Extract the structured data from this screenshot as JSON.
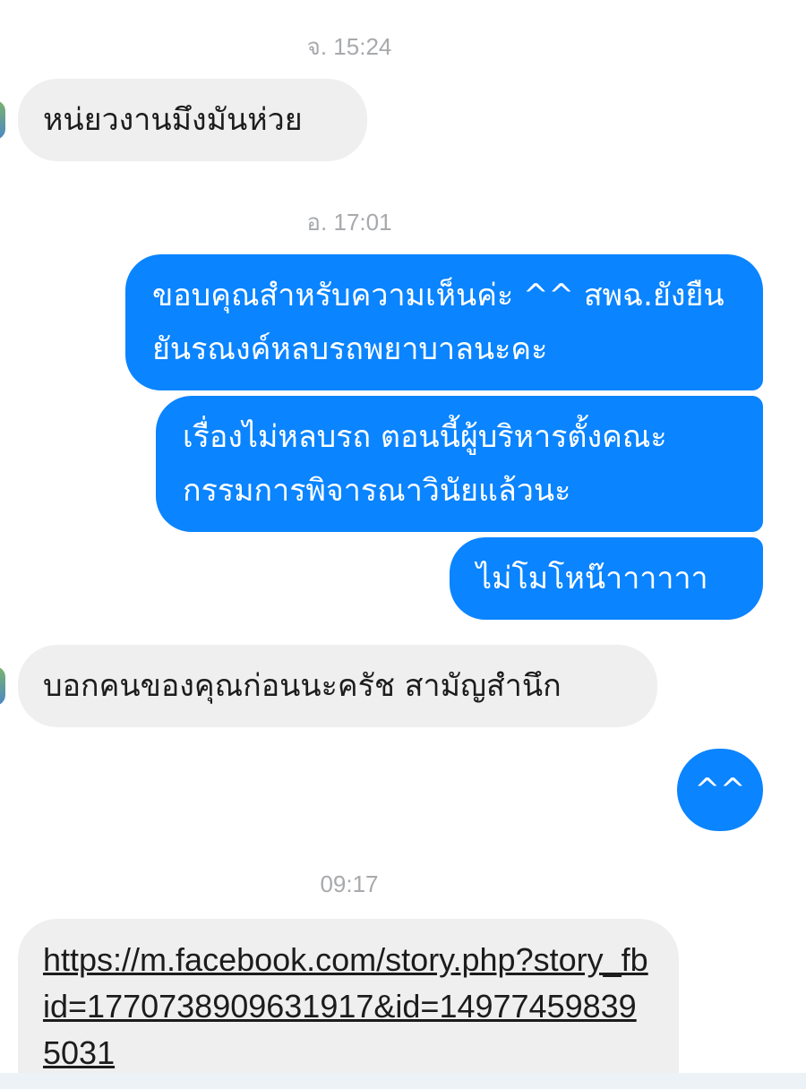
{
  "thread": {
    "groups": [
      {
        "timestamp": "จ. 15:24",
        "messages": [
          {
            "direction": "incoming",
            "text": "หน่ยวงานมึงมันห่วย"
          }
        ]
      },
      {
        "timestamp": "อ. 17:01",
        "messages": [
          {
            "direction": "outgoing",
            "text": "ขอบคุณสำหรับความเห็นค่ะ ^^ สพฉ.ยังยืนยันรณงค์หลบรถพยาบาลนะคะ"
          },
          {
            "direction": "outgoing",
            "text": "เรื่องไม่หลบรถ ตอนนี้ผู้บริหารตั้งคณะกรรมการพิจารณาวินัยแล้วนะ"
          },
          {
            "direction": "outgoing",
            "text": "ไม่โมโหน๊าาาาาา"
          },
          {
            "direction": "incoming",
            "text": "บอกคนของคุณก่อนนะครัช สามัญสำนึก"
          },
          {
            "direction": "outgoing",
            "text": "^^"
          }
        ]
      },
      {
        "timestamp": "09:17",
        "messages": [
          {
            "direction": "incoming",
            "type": "link",
            "text": "https://m.facebook.com/story.php?story_fbid=1770738909631917&id=149774598395031"
          }
        ]
      }
    ]
  },
  "colors": {
    "outgoing_bubble": "#0a84ff",
    "incoming_bubble": "#efefef",
    "timestamp": "#a7a9ac"
  }
}
